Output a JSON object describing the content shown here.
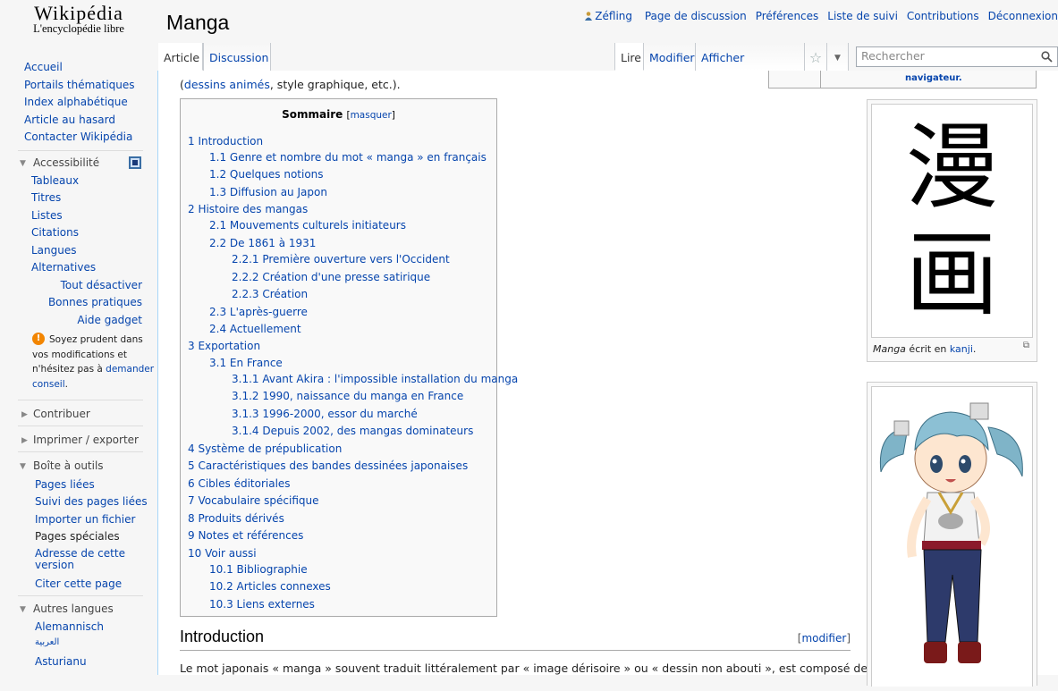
{
  "logo": {
    "line1": "Wikipédia",
    "line2": "L'encyclopédie libre"
  },
  "personal_tools": {
    "user": "Zéfling",
    "items": [
      "Page de discussion",
      "Préférences",
      "Liste de suivi",
      "Contributions",
      "Déconnexion"
    ]
  },
  "page_title": "Manga",
  "tabs": {
    "article": "Article",
    "discussion": "Discussion",
    "read": "Lire",
    "edit": "Modifier",
    "history": "Afficher l'historique"
  },
  "search": {
    "placeholder": "Rechercher"
  },
  "sidebar": {
    "nav": [
      "Accueil",
      "Portails thématiques",
      "Index alphabétique",
      "Article au hasard",
      "Contacter Wikipédia"
    ],
    "accessibility": {
      "heading": "Accessibilité",
      "items": [
        "Tableaux",
        "Titres",
        "Listes",
        "Citations",
        "Langues",
        "Alternatives"
      ],
      "right_items": [
        "Tout désactiver",
        "Bonnes pratiques",
        "Aide gadget"
      ],
      "warning": [
        "Soyez prudent dans",
        "vos modifications et",
        "n'hésitez pas à"
      ],
      "warning_link1": "demander",
      "warning_link2": "conseil"
    },
    "contribute": "Contribuer",
    "print": "Imprimer / exporter",
    "toolbox": {
      "heading": "Boîte à outils",
      "items": [
        "Pages liées",
        "Suivi des pages liées",
        "Importer un fichier",
        "Pages spéciales",
        "Adresse de cette",
        "Citer cette page"
      ],
      "item5_line2": "version"
    },
    "languages": {
      "heading": "Autres langues",
      "items": [
        "Alemannisch",
        "العربية",
        "Asturianu"
      ]
    }
  },
  "content": {
    "intro_line": {
      "open": "(",
      "link": "dessins animés",
      "rest": ", style graphique, etc.)."
    },
    "infobox_remnant": "navigateur.",
    "toc": {
      "title": "Sommaire",
      "toggle": "masquer",
      "items": [
        {
          "t": "1 Introduction",
          "lvl": 0
        },
        {
          "t": "1.1 Genre et nombre du mot « manga » en français",
          "lvl": 1
        },
        {
          "t": "1.2 Quelques notions",
          "lvl": 1
        },
        {
          "t": "1.3 Diffusion au Japon",
          "lvl": 1
        },
        {
          "t": "2 Histoire des mangas",
          "lvl": 0
        },
        {
          "t": "2.1 Mouvements culturels initiateurs",
          "lvl": 1
        },
        {
          "t": "2.2 De 1861 à 1931",
          "lvl": 1
        },
        {
          "t": "2.2.1 Première ouverture vers l'Occident",
          "lvl": 2
        },
        {
          "t": "2.2.2 Création d'une presse satirique",
          "lvl": 2
        },
        {
          "t": "2.2.3 Création",
          "lvl": 2
        },
        {
          "t": "2.3 L'après-guerre",
          "lvl": 1
        },
        {
          "t": "2.4 Actuellement",
          "lvl": 1
        },
        {
          "t": "3 Exportation",
          "lvl": 0
        },
        {
          "t": "3.1 En France",
          "lvl": 1
        },
        {
          "t": "3.1.1 Avant Akira : l'impossible installation du manga",
          "lvl": 2
        },
        {
          "t": "3.1.2 1990, naissance du manga en France",
          "lvl": 2
        },
        {
          "t": "3.1.3 1996-2000, essor du marché",
          "lvl": 2
        },
        {
          "t": "3.1.4 Depuis 2002, des mangas dominateurs",
          "lvl": 2
        },
        {
          "t": "4 Système de prépublication",
          "lvl": 0
        },
        {
          "t": "5 Caractéristiques des bandes dessinées japonaises",
          "lvl": 0
        },
        {
          "t": "6 Cibles éditoriales",
          "lvl": 0
        },
        {
          "t": "7 Vocabulaire spécifique",
          "lvl": 0
        },
        {
          "t": "8 Produits dérivés",
          "lvl": 0
        },
        {
          "t": "9 Notes et références",
          "lvl": 0
        },
        {
          "t": "10 Voir aussi",
          "lvl": 0
        },
        {
          "t": "10.1 Bibliographie",
          "lvl": 1
        },
        {
          "t": "10.2 Articles connexes",
          "lvl": 1
        },
        {
          "t": "10.3 Liens externes",
          "lvl": 1
        }
      ]
    },
    "section_heading": "Introduction",
    "section_edit": "modifier",
    "paragraph": "Le mot japonais « manga » souvent traduit littéralement par « image dérisoire » ou « dessin non abouti », est composé de « ga »",
    "thumb1": {
      "kanji": [
        "漫",
        "画"
      ],
      "caption_italic": "Manga",
      "caption_text": " écrit en ",
      "caption_link": "kanji",
      "caption_end": "."
    }
  },
  "colors": {
    "link": "#0645ad",
    "border_blue": "#a7d7f9"
  }
}
